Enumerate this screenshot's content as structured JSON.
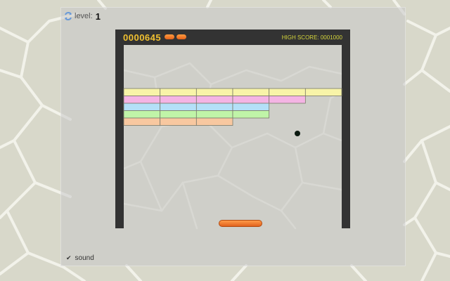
{
  "hud": {
    "level_label": "level:",
    "level_value": "1",
    "score": "0000645",
    "lives": 2,
    "high_score": "HIGH SCORE: 0001000",
    "sound_label": "sound",
    "sound_checked": true
  },
  "colors": {
    "frame": "#333333",
    "score_text": "#f0c030",
    "high_score_text": "#d4d43a",
    "paddle": "#f07a30",
    "ball": "#0c1a10"
  },
  "bricks": {
    "rows": [
      {
        "color": "#f8f4a8",
        "count": 6
      },
      {
        "color": "#f4b4e4",
        "count": 5
      },
      {
        "color": "#b4e0f8",
        "count": 4
      },
      {
        "color": "#c0f4a8",
        "count": 4
      },
      {
        "color": "#f8c8a0",
        "count": 3
      }
    ]
  }
}
